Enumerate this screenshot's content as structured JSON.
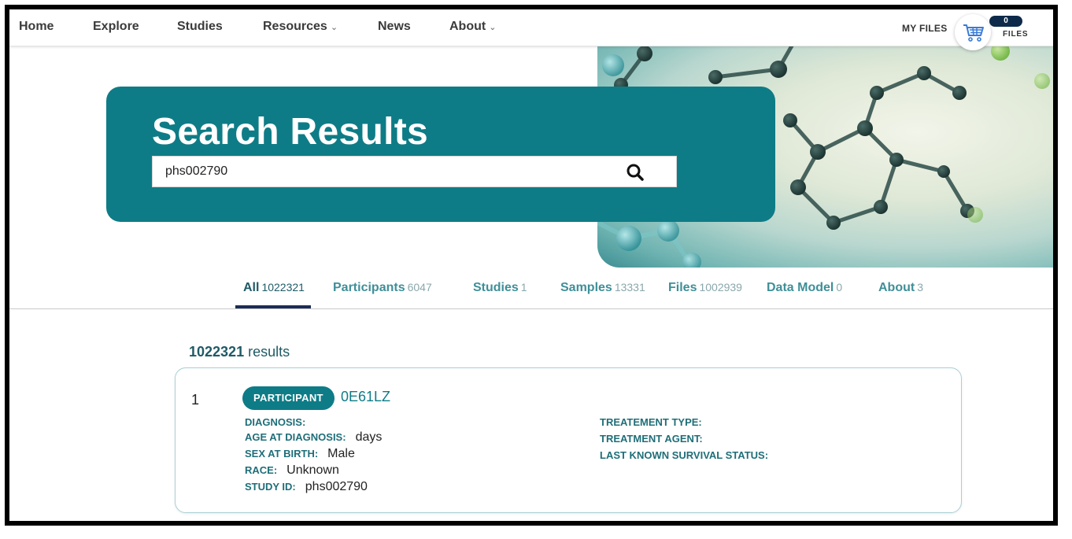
{
  "nav": {
    "items": [
      "Home",
      "Explore",
      "Studies",
      "Resources",
      "News",
      "About"
    ],
    "my_files": "MY FILES",
    "files_count": "0",
    "files_label": "FILES"
  },
  "hero": {
    "title": "Search Results",
    "search_value": "phs002790"
  },
  "tabs": [
    {
      "label": "All",
      "count": "1022321"
    },
    {
      "label": "Participants",
      "count": "6047"
    },
    {
      "label": "Studies",
      "count": "1"
    },
    {
      "label": "Samples",
      "count": "13331"
    },
    {
      "label": "Files",
      "count": "1002939"
    },
    {
      "label": "Data Model",
      "count": "0"
    },
    {
      "label": "About",
      "count": "3"
    }
  ],
  "results": {
    "count": "1022321",
    "label": "results"
  },
  "card": {
    "index": "1",
    "type": "PARTICIPANT",
    "id": "0E61LZ",
    "left_fields": [
      {
        "label": "DIAGNOSIS:",
        "value": ""
      },
      {
        "label": "AGE AT DIAGNOSIS:",
        "value": "days"
      },
      {
        "label": "SEX AT BIRTH:",
        "value": "Male"
      },
      {
        "label": "RACE:",
        "value": "Unknown"
      },
      {
        "label": "STUDY ID:",
        "value": "phs002790"
      }
    ],
    "right_fields": [
      {
        "label": "TREATEMENT TYPE:",
        "value": ""
      },
      {
        "label": "TREATMENT AGENT:",
        "value": ""
      },
      {
        "label": "LAST KNOWN SURVIVAL STATUS:",
        "value": ""
      }
    ]
  },
  "colors": {
    "teal": "#0e7c86",
    "dark_navy": "#1c2c57",
    "tab_text": "#3f8f98"
  }
}
